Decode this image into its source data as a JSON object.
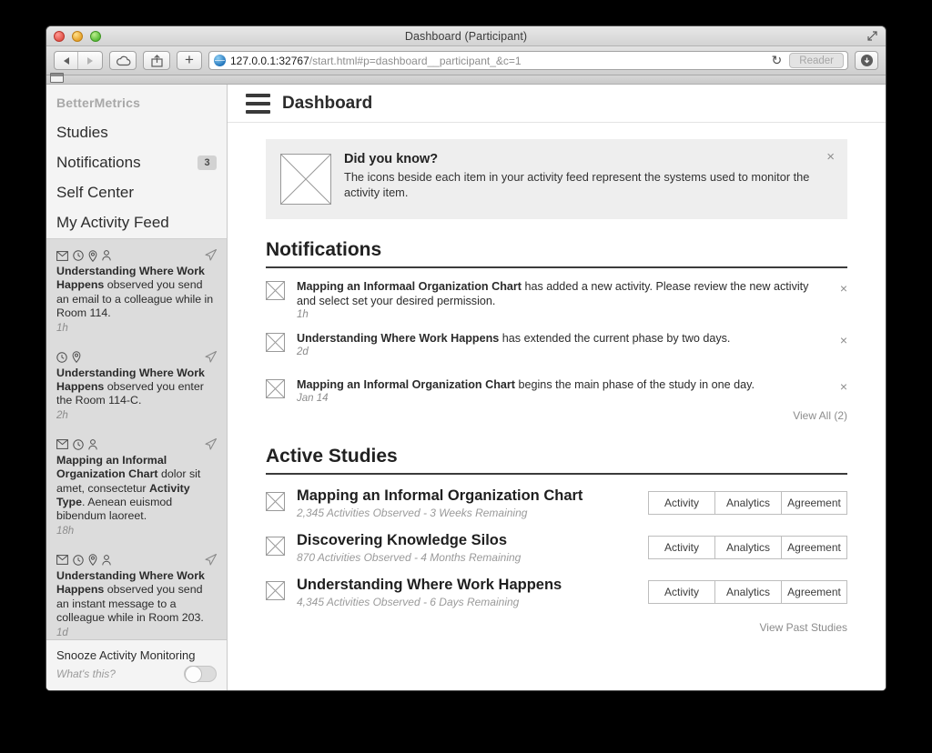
{
  "window": {
    "title": "Dashboard (Participant)",
    "traffic_lights": [
      "close",
      "minimize",
      "zoom"
    ]
  },
  "browser": {
    "url_host": "127.0.0.1:32767",
    "url_path": "/start.html#p=dashboard__participant_&c=1",
    "reader_label": "Reader",
    "reload_glyph": "↻",
    "plus_glyph": "+",
    "download_glyph": "⬇"
  },
  "sidebar": {
    "brand": "BetterMetrics",
    "nav": [
      {
        "label": "Studies",
        "badge": null
      },
      {
        "label": "Notifications",
        "badge": "3"
      },
      {
        "label": "Self Center",
        "badge": null
      },
      {
        "label": "My Activity Feed",
        "badge": null
      }
    ],
    "feed": [
      {
        "icons": [
          "mail-icon",
          "clock-icon",
          "location-icon",
          "person-icon"
        ],
        "study": "Understanding Where Work Happens",
        "rest": " observed you send an email to a colleague while in Room 114.",
        "time": "1h"
      },
      {
        "icons": [
          "clock-icon",
          "location-icon"
        ],
        "study": "Understanding Where Work Happens",
        "rest": " observed you enter the Room 114-C.",
        "time": "2h"
      },
      {
        "icons": [
          "mail-icon",
          "clock-icon",
          "person-icon"
        ],
        "study": "Mapping an Informal Organization Chart",
        "rest": " dolor sit amet, consectetur ",
        "emphasis": "Activity Type",
        "tail": ". Aenean euismod bibendum laoreet.",
        "time": "18h"
      },
      {
        "icons": [
          "mail-icon",
          "clock-icon",
          "location-icon",
          "person-icon"
        ],
        "study": "Understanding Where Work Happens",
        "rest": " observed you send an instant message to a colleague while in Room 203.",
        "time": "1d"
      }
    ],
    "snooze": {
      "title": "Snooze Activity Monitoring",
      "hint": "What's this?",
      "toggle_state": "off"
    }
  },
  "main": {
    "page_title": "Dashboard",
    "banner": {
      "title": "Did you know?",
      "text": "The icons beside each item in your activity feed represent the systems used to monitor the activity item.",
      "close_glyph": "×"
    },
    "notifications": {
      "heading": "Notifications",
      "items": [
        {
          "study": "Mapping an Informaal Organization Chart",
          "rest": " has added a new activity. Please review the new activity and select set your desired permission.",
          "time": "1h"
        },
        {
          "study": "Understanding Where Work Happens",
          "rest": " has extended the current phase by two days.",
          "time": "2d"
        },
        {
          "study": "Mapping an Informal Organization Chart",
          "rest": " begins the main phase of the study in one day.",
          "time": "Jan 14"
        }
      ],
      "view_all": "View All (2)",
      "close_glyph": "×"
    },
    "studies": {
      "heading": "Active Studies",
      "items": [
        {
          "title": "Mapping an Informal Organization Chart",
          "meta": "2,345 Activities Observed - 3 Weeks Remaining",
          "buttons": [
            "Activity",
            "Analytics",
            "Agreement"
          ]
        },
        {
          "title": "Discovering Knowledge Silos",
          "meta": "870 Activities Observed - 4 Months Remaining",
          "buttons": [
            "Activity",
            "Analytics",
            "Agreement"
          ]
        },
        {
          "title": "Understanding Where Work Happens",
          "meta": "4,345 Activities Observed - 6 Days Remaining",
          "buttons": [
            "Activity",
            "Analytics",
            "Agreement"
          ]
        }
      ],
      "view_past": "View Past Studies"
    }
  },
  "colors": {
    "sidebar_bg": "#f4f4f4",
    "feed_bg": "#dcdcdc",
    "banner_bg": "#eeeeee",
    "rule": "#3b3b3b"
  }
}
